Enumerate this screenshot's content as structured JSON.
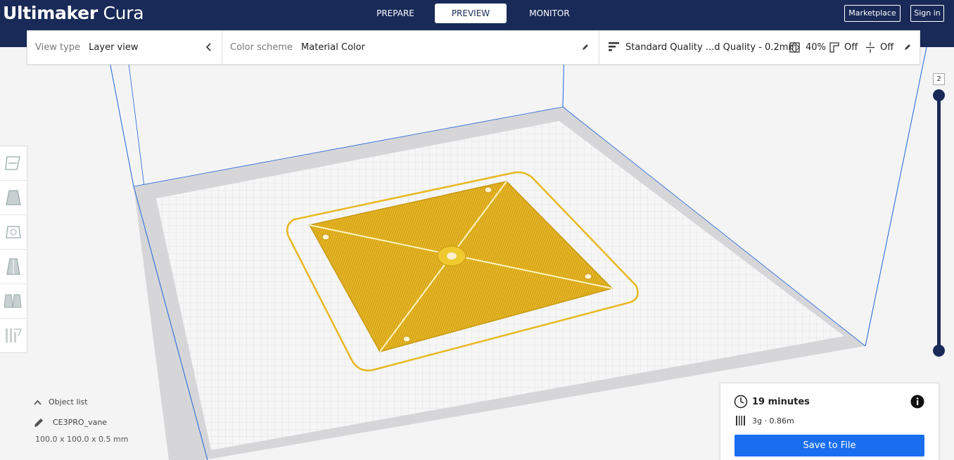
{
  "app": {
    "logo_bold": "Ultimaker",
    "logo_light": "Cura"
  },
  "header": {
    "tabs": [
      {
        "label": "PREPARE",
        "active": false
      },
      {
        "label": "PREVIEW",
        "active": true
      },
      {
        "label": "MONITOR",
        "active": false
      }
    ],
    "marketplace_label": "Marketplace",
    "signin_label": "Sign in"
  },
  "settings_bar": {
    "view_type_label": "View type",
    "view_type_value": "Layer view",
    "color_scheme_label": "Color scheme",
    "color_scheme_value": "Material Color",
    "profile": "Standard Quality ...d Quality - 0.2mm",
    "infill": "40%",
    "support": "Off",
    "adhesion": "Off"
  },
  "layer_slider": {
    "value": "2"
  },
  "object_list": {
    "header": "Object list",
    "item_name": "CE3PRO_vane",
    "dimensions": "100.0 x 100.0 x 0.5 mm"
  },
  "print_info": {
    "time": "19 minutes",
    "material": "3g · 0.86m",
    "save_label": "Save to File"
  },
  "colors": {
    "header_bg": "#192a58",
    "accent_blue": "#196ef0",
    "material_yellow": "#e8b820",
    "build_volume_line": "#1e64dc"
  },
  "icons": {
    "view_collapse": "chevron-left-icon",
    "edit": "pencil-icon",
    "profile": "profile-bars-icon",
    "infill": "infill-icon",
    "support": "support-icon",
    "adhesion": "adhesion-icon",
    "time": "clock-icon",
    "info": "info-icon",
    "material": "filament-icon"
  }
}
